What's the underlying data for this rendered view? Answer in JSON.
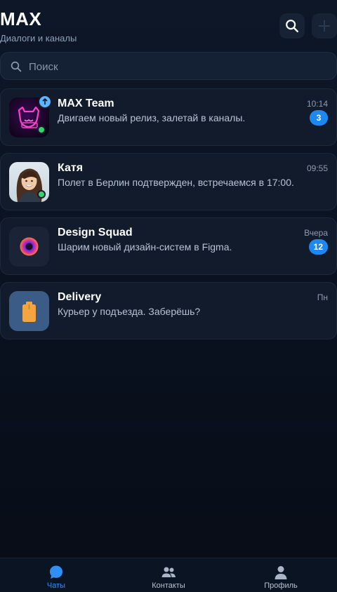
{
  "header": {
    "title": "MAX",
    "subtitle": "Диалоги и каналы"
  },
  "search": {
    "placeholder": "Поиск"
  },
  "chats": [
    {
      "name": "MAX Team",
      "message": "Двигаем новый релиз, залетай в каналы.",
      "time": "10:14",
      "unread": "3",
      "online": true,
      "pinned": true,
      "avatar_icon": "neon-cat-logo"
    },
    {
      "name": "Катя",
      "message": "Полет в Берлин подтвержден, встречаемся в 17:00.",
      "time": "09:55",
      "unread": "",
      "online": true,
      "avatar_icon": "user-photo"
    },
    {
      "name": "Design Squad",
      "message": "Шарим новый дизайн-систем в Figma.",
      "time": "Вчера",
      "unread": "12",
      "online": false,
      "avatar_icon": "gradient-circle"
    },
    {
      "name": "Delivery",
      "message": "Курьер у подъезда. Заберёшь?",
      "time": "Пн",
      "unread": "",
      "online": false,
      "avatar_icon": "package-box"
    }
  ],
  "nav": {
    "chats": "Чаты",
    "contacts": "Контакты",
    "profile": "Профиль",
    "active": "chats"
  },
  "colors": {
    "accent": "#1e88f2",
    "online": "#35d36b",
    "background": "#0a1220"
  }
}
